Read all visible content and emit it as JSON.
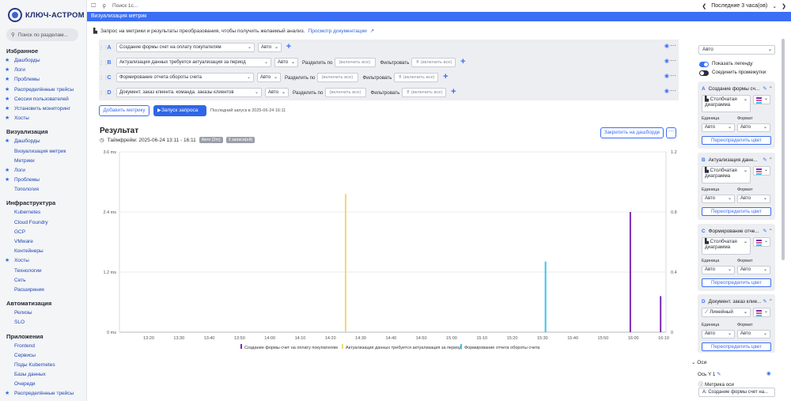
{
  "sidebar": {
    "logo": "КЛЮЧ-АСТРОМ",
    "search_placeholder": "Поиск по разделам...",
    "sections": [
      {
        "title": "Избранное",
        "items": [
          {
            "label": "Дашборды",
            "star": true
          },
          {
            "label": "Логи",
            "star": true
          },
          {
            "label": "Проблемы",
            "star": true
          },
          {
            "label": "Распределённые трейсы",
            "star": true
          },
          {
            "label": "Сессии пользователей",
            "star": true
          },
          {
            "label": "Установить мониторинг",
            "star": true
          },
          {
            "label": "Хосты",
            "star": true
          }
        ]
      },
      {
        "title": "Визуализация",
        "items": [
          {
            "label": "Дашборды",
            "star": true
          },
          {
            "label": "Визуализация метрик",
            "star": false
          },
          {
            "label": "Метрики",
            "star": false
          },
          {
            "label": "Логи",
            "star": true
          },
          {
            "label": "Проблемы",
            "star": true
          },
          {
            "label": "Топология",
            "star": false
          }
        ]
      },
      {
        "title": "Инфраструктура",
        "items": [
          {
            "label": "Kubernetes",
            "star": false
          },
          {
            "label": "Cloud Foundry",
            "star": false
          },
          {
            "label": "GCP",
            "star": false
          },
          {
            "label": "VMware",
            "star": false
          },
          {
            "label": "Контейнеры",
            "star": false
          },
          {
            "label": "Хосты",
            "star": true
          },
          {
            "label": "Технологии",
            "star": false
          },
          {
            "label": "Сеть",
            "star": false
          },
          {
            "label": "Расширения",
            "star": false
          }
        ]
      },
      {
        "title": "Автоматизация",
        "items": [
          {
            "label": "Релизы",
            "star": false
          },
          {
            "label": "SLO",
            "star": false
          }
        ]
      },
      {
        "title": "Приложения",
        "items": [
          {
            "label": "Frontend",
            "star": false
          },
          {
            "label": "Сервисы",
            "star": false
          },
          {
            "label": "Поды Kubernetes",
            "star": false
          },
          {
            "label": "Базы данных",
            "star": false
          },
          {
            "label": "Очереди",
            "star": false
          },
          {
            "label": "Распределённые трейсы",
            "star": true
          }
        ]
      }
    ]
  },
  "topbar": {
    "search_placeholder": "Поиск 1с...",
    "timeframe": "Последние 3 часа(ов)"
  },
  "page_title": "Визуализация метрик",
  "info": {
    "text": "Запрос на метрики и результаты преобразования, чтобы получить желаемый анализ.",
    "link": "Просмотр документации"
  },
  "queries": [
    {
      "letter": "A",
      "metric": "Создание формы счет на оплату покупателям",
      "agg": "Авто",
      "split_label": "",
      "split": "",
      "filter_label": "",
      "filter": ""
    },
    {
      "letter": "B",
      "metric": "Актуализация данных требуется актуализация за период",
      "agg": "Авто",
      "split_label": "Разделить по",
      "split": "(включить все)",
      "filter_label": "Фильтровать",
      "filter": "(включить все)"
    },
    {
      "letter": "C",
      "metric": "Формирование отчета обороты счета",
      "agg": "Авто",
      "split_label": "Разделить по",
      "split": "(включить все)",
      "filter_label": "Фильтровать",
      "filter": "(включить все)"
    },
    {
      "letter": "D",
      "metric": "Документ. заказ клиента. команда. заказы клиентов",
      "agg": "Авто",
      "split_label": "Разделить по",
      "split": "(включить все)",
      "filter_label": "Фильтровать",
      "filter": "(включить все)"
    }
  ],
  "actions": {
    "add_metric": "Добавить метрику",
    "run_query": "Запуск запроса",
    "last_run": "Последний запуск в 2025-06-24 16:11"
  },
  "result": {
    "title": "Результат",
    "timeframe": "Таймфрейм: 2025-06-24 13:11 - 16:11",
    "badge_auto": "Авто (2m)",
    "badge_records": "3 записи(ей)",
    "pin_button": "Закрепить на дашборде"
  },
  "chart_data": {
    "type": "bar",
    "x": [
      "13:20",
      "13:30",
      "13:40",
      "13:50",
      "14:00",
      "14:10",
      "14:20",
      "14:30",
      "14:40",
      "14:50",
      "15:00",
      "15:10",
      "15:20",
      "15:30",
      "15:40",
      "15:50",
      "16:00",
      "16:10"
    ],
    "y_left_ticks": [
      "0 ms",
      "1.2 ms",
      "2.4 ms",
      "3.6 ms"
    ],
    "y_left_lim": [
      0,
      3.6
    ],
    "y_right_ticks": [
      "0",
      "0.4",
      "0.8",
      "1.2"
    ],
    "y_right_lim": [
      0,
      1.2
    ],
    "series": [
      {
        "name": "Создание формы счет на оплату покупателям",
        "color": "#7b2ab5",
        "axis": "left",
        "points": [
          {
            "x": "15:59",
            "y": 2.4
          },
          {
            "x": "16:09",
            "y": 0.72
          }
        ]
      },
      {
        "name": "Актуализация данных требуется актуализация за период",
        "color": "#f0d77a",
        "axis": "right",
        "points": [
          {
            "x": "14:25",
            "y": 0.92
          }
        ]
      },
      {
        "name": "Формирование отчета обороты счета",
        "color": "#36c6ee",
        "axis": "right",
        "points": [
          {
            "x": "15:31",
            "y": 0.47
          }
        ]
      }
    ]
  },
  "right_panel": {
    "auto_select": "Авто",
    "show_legend": "Показать легенду",
    "connect_gaps": "Соединить промежутки",
    "unit_label": "Единица",
    "format_label": "Формат",
    "auto": "Авто",
    "override_color": "Переопределить цвет",
    "cards": [
      {
        "letter": "A",
        "title": "Создание формы сч...",
        "type": "Столбчатая диаграмма"
      },
      {
        "letter": "B",
        "title": "Актуализация данн...",
        "type": "Столбчатая диаграмма"
      },
      {
        "letter": "C",
        "title": "Формирование отче...",
        "type": "Столбчатая диаграмма"
      },
      {
        "letter": "D",
        "title": "Документ. заказ клие...",
        "type": "Линейный"
      }
    ],
    "axes_label": "Оси",
    "axis_y1": "Ось Y 1",
    "axis_metric": "Метрика оси",
    "axis_metric_value": "A: Создание формы счет на..."
  }
}
